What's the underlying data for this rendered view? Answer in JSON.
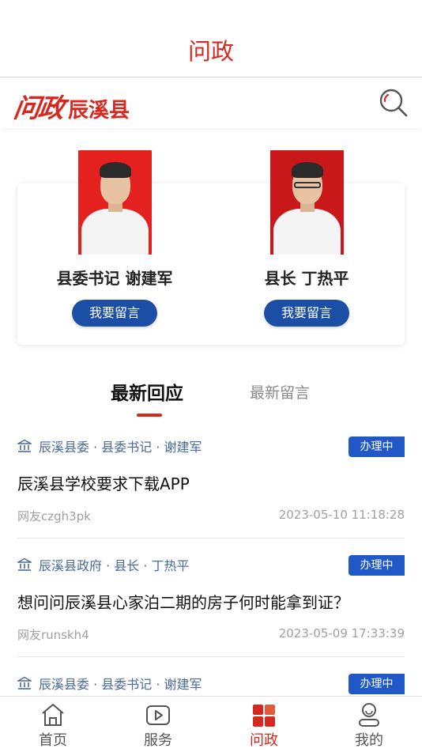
{
  "header": {
    "title": "问政"
  },
  "brand": {
    "logo_text": "问政",
    "county": "辰溪县"
  },
  "icons": {
    "search": "search-icon",
    "bank": "government-building-icon",
    "home": "home-icon",
    "service": "play-icon",
    "wenzheng": "grid-squares-icon",
    "mine": "user-icon"
  },
  "colors": {
    "accent_red": "#d7281f",
    "button_blue": "#1b4fa6",
    "badge_blue": "#2158c7"
  },
  "leaders": [
    {
      "title_name": "县委书记 谢建军",
      "button_label": "我要留言"
    },
    {
      "title_name": "县长 丁热平",
      "button_label": "我要留言"
    }
  ],
  "tabs": [
    {
      "label": "最新回应",
      "active": true
    },
    {
      "label": "最新留言",
      "active": false
    }
  ],
  "posts": [
    {
      "dept": "辰溪县委 · 县委书记 · 谢建军",
      "status": "办理中",
      "question": "辰溪县学校要求下载APP",
      "user": "网友czgh3pk",
      "time": "2023-05-10 11:18:28"
    },
    {
      "dept": "辰溪县政府 · 县长 · 丁热平",
      "status": "办理中",
      "question": "想问问辰溪县心家泊二期的房子何时能拿到证？",
      "user": "网友runskh4",
      "time": "2023-05-09 17:33:39"
    },
    {
      "dept": "辰溪县委 · 县委书记 · 谢建军",
      "status": "办理中"
    }
  ],
  "nav": [
    {
      "label": "首页"
    },
    {
      "label": "服务"
    },
    {
      "label": "问政",
      "active": true
    },
    {
      "label": "我的"
    }
  ]
}
